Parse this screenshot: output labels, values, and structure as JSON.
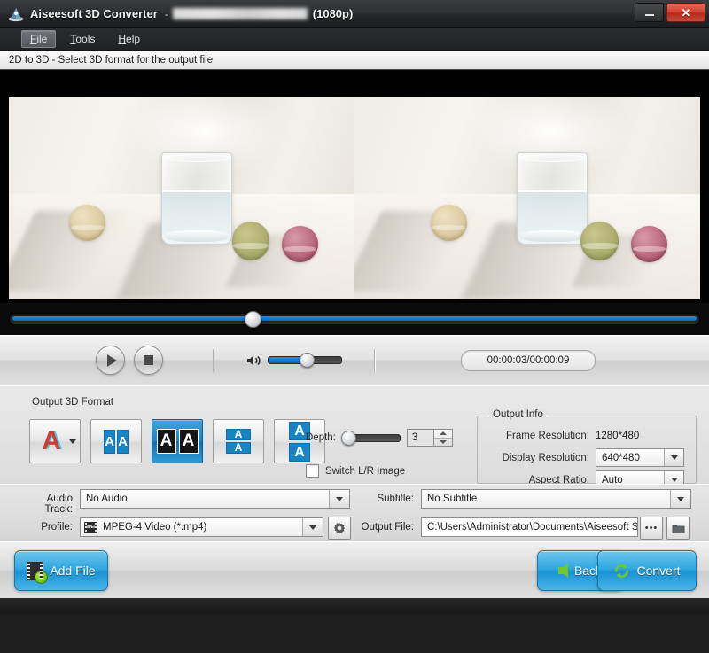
{
  "window": {
    "app_title": "Aiseesoft 3D Converter",
    "title_separator": "-",
    "title_file_redacted": "",
    "title_resolution": "(1080p)",
    "minimize_label": "",
    "close_label": "✕",
    "app_icon": "aiseesoft-logo-icon"
  },
  "menu": {
    "items": [
      {
        "mnemonic": "F",
        "rest": "ile",
        "active": true
      },
      {
        "mnemonic": "T",
        "rest": "ools",
        "active": false
      },
      {
        "mnemonic": "H",
        "rest": "elp",
        "active": false
      }
    ]
  },
  "status": {
    "text": "2D to 3D - Select 3D format for the output file"
  },
  "preview": {
    "left_pane_name": "left-eye-preview",
    "right_pane_name": "right-eye-preview",
    "description": "Glass of water with three macarons on white cloth"
  },
  "seek": {
    "position_percent": 34,
    "buffered_percent": 100
  },
  "transport": {
    "play_label": "",
    "stop_label": "",
    "volume_percent": 50,
    "time_display": "00:00:03/00:00:09"
  },
  "format": {
    "group_label": "Output 3D Format",
    "buttons": [
      {
        "name": "anaglyph-format-button",
        "glyph": "A",
        "type": "anaglyph",
        "selected": false,
        "has_dropdown": true
      },
      {
        "name": "side-by-side-half-button",
        "glyph": "A",
        "type": "sbs-half",
        "selected": false,
        "has_dropdown": false
      },
      {
        "name": "side-by-side-full-button",
        "glyph": "A",
        "type": "sbs-full",
        "selected": true,
        "has_dropdown": false
      },
      {
        "name": "top-bottom-half-button",
        "glyph": "A",
        "type": "tb-half",
        "selected": false,
        "has_dropdown": false
      },
      {
        "name": "top-bottom-full-button",
        "glyph": "A",
        "type": "tb-full",
        "selected": false,
        "has_dropdown": false
      }
    ],
    "depth_label": "Depth:",
    "depth_value": "3",
    "depth_percent": 0,
    "switch_lr_label": "Switch L/R Image",
    "switch_lr_checked": false
  },
  "output_info": {
    "title": "Output Info",
    "frame_resolution_label": "Frame Resolution:",
    "frame_resolution_value": "1280*480",
    "display_resolution_label": "Display Resolution:",
    "display_resolution_value": "640*480",
    "aspect_ratio_label": "Aspect Ratio:",
    "aspect_ratio_value": "Auto"
  },
  "form": {
    "audio_track_label": "Audio Track:",
    "audio_track_value": "No Audio",
    "profile_label": "Profile:",
    "profile_value": "MPEG-4 Video (*.mp4)",
    "profile_icon_text": "MPEG",
    "subtitle_label": "Subtitle:",
    "subtitle_value": "No Subtitle",
    "output_file_label": "Output File:",
    "output_file_value": "C:\\Users\\Administrator\\Documents\\Aiseesoft Stu",
    "browse_label": "•••",
    "settings_icon": "gear-icon",
    "folder_icon": "folder-icon"
  },
  "actions": {
    "add_file_label": "Add File",
    "back_label": "Back",
    "convert_label": "Convert"
  },
  "colors": {
    "accent_blue": "#1b93d4",
    "seek_blue": "#0a63c2",
    "selected_tile": "#1784c4",
    "green_accent": "#6fc82a",
    "close_red": "#d2412f"
  }
}
